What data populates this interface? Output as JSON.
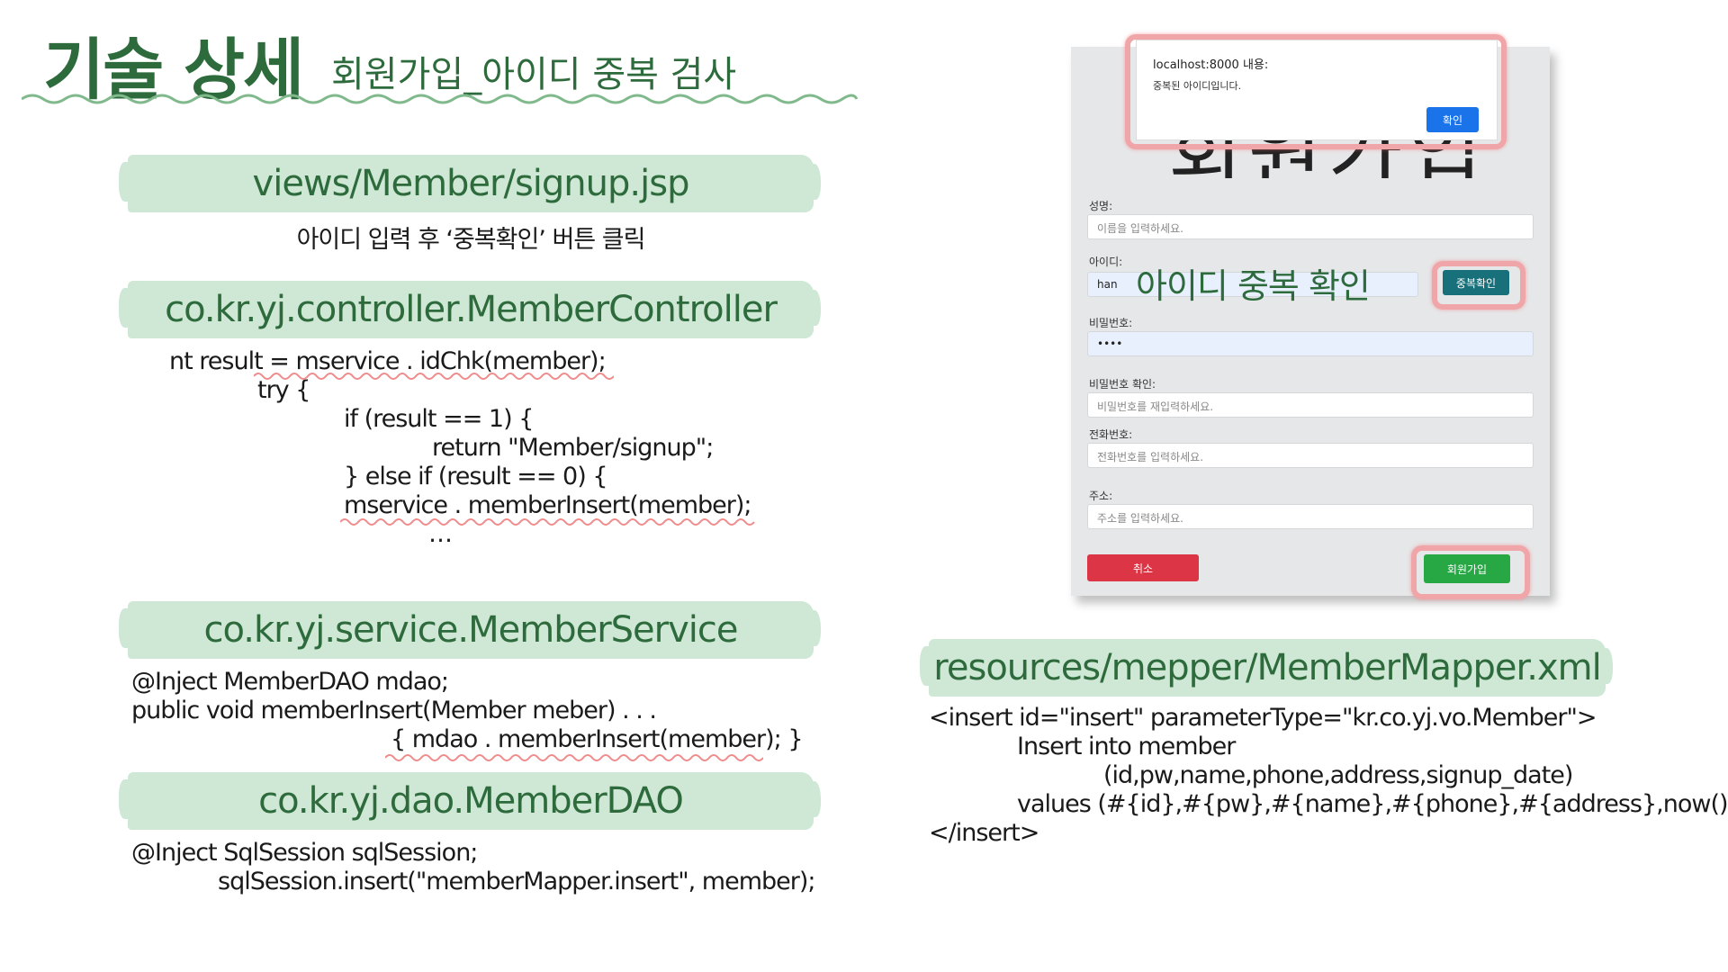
{
  "header": {
    "title": "기술 상세",
    "subtitle": "회원가입_아이디 중복 검사"
  },
  "sections": {
    "view": {
      "file": "views/Member/signup.jsp",
      "desc": "아이디 입력 후 ‘중복확인’ 버튼 클릭"
    },
    "controller": {
      "class": "co.kr.yj.controller.MemberController",
      "code": [
        "nt result = mservice . idChk(member);",
        "try {",
        "if (result == 1) {",
        "return \"Member/signup\";",
        "} else if (result == 0) {",
        "mservice . memberInsert(member);",
        "…"
      ]
    },
    "service": {
      "class": "co.kr.yj.service.MemberService",
      "code": [
        "@Inject MemberDAO  mdao;",
        "public void memberInsert(Member meber) . . .",
        "{ mdao . memberInsert(member); }"
      ]
    },
    "dao": {
      "class": "co.kr.yj.dao.MemberDAO",
      "code": [
        "@Inject SqlSession sqlSession;",
        "sqlSession.insert(\"memberMapper.insert\", member);"
      ]
    },
    "mapper": {
      "file": "resources/mepper/MemberMapper.xml",
      "code": [
        "<insert id=\"insert\" parameterType=\"kr.co.yj.vo.Member\">",
        "Insert into member",
        "(id,pw,name,phone,address,signup_date)",
        "values (#{id},#{pw},#{name},#{phone},#{address},now())",
        "</insert>"
      ]
    }
  },
  "screenshot": {
    "page_title": "회원가입",
    "dialog": {
      "title": "localhost:8000 내용:",
      "message": "중복된 아이디입니다.",
      "ok_label": "확인"
    },
    "fields": [
      {
        "label": "성명:",
        "placeholder": "이름을 입력하세요.",
        "value": ""
      },
      {
        "label": "아이디:",
        "placeholder": "",
        "value": "han"
      },
      {
        "label": "비밀번호:",
        "placeholder": "",
        "value": "••••"
      },
      {
        "label": "비밀번호 확인:",
        "placeholder": "비밀번호를 재입력하세요.",
        "value": ""
      },
      {
        "label": "전화번호:",
        "placeholder": "전화번호를 입력하세요.",
        "value": ""
      },
      {
        "label": "주소:",
        "placeholder": "주소를 입력하세요.",
        "value": ""
      }
    ],
    "dup_check_label": "중복확인",
    "overlay_label": "아이디 중복 확인",
    "cancel_label": "취소",
    "signup_label": "회원가입"
  },
  "colors": {
    "accent_green": "#2e6b3c",
    "banner_green": "#cfe7d5",
    "highlight_pink": "#f0a5a8",
    "cancel_red": "#dc3545",
    "signup_green": "#28a745",
    "dup_teal": "#17707a",
    "dialog_blue": "#1a73e8"
  }
}
